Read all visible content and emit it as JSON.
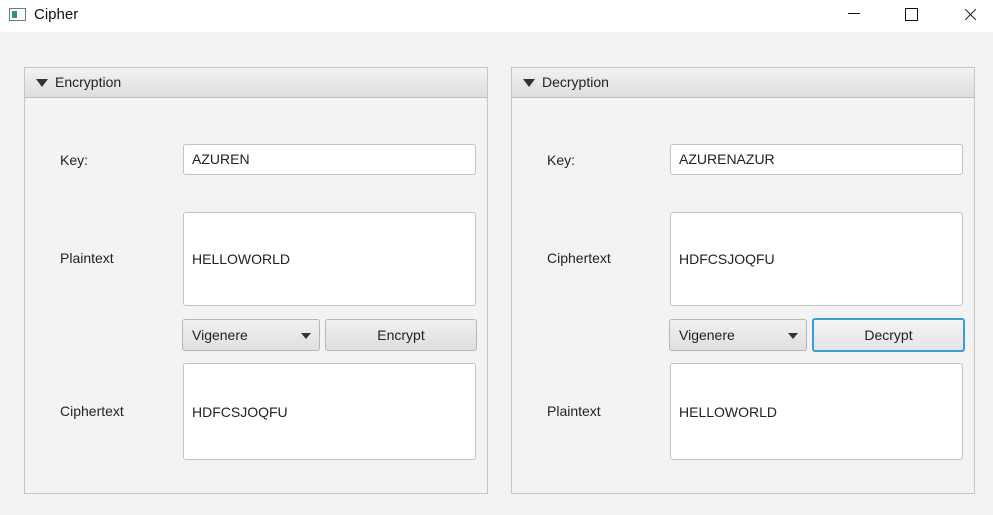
{
  "window": {
    "title": "Cipher"
  },
  "encryption": {
    "title": "Encryption",
    "key_label": "Key:",
    "key_value": "AZUREN",
    "plaintext_label": "Plaintext",
    "plaintext_value": "HELLOWORLD",
    "cipher_select": "Vigenere",
    "action_label": "Encrypt",
    "ciphertext_label": "Ciphertext",
    "ciphertext_value": "HDFCSJOQFU"
  },
  "decryption": {
    "title": "Decryption",
    "key_label": "Key:",
    "key_value": "AZURENAZUR",
    "ciphertext_label": "Ciphertext",
    "ciphertext_value": "HDFCSJOQFU",
    "cipher_select": "Vigenere",
    "action_label": "Decrypt",
    "plaintext_label": "Plaintext",
    "plaintext_value": "HELLOWORLD"
  }
}
